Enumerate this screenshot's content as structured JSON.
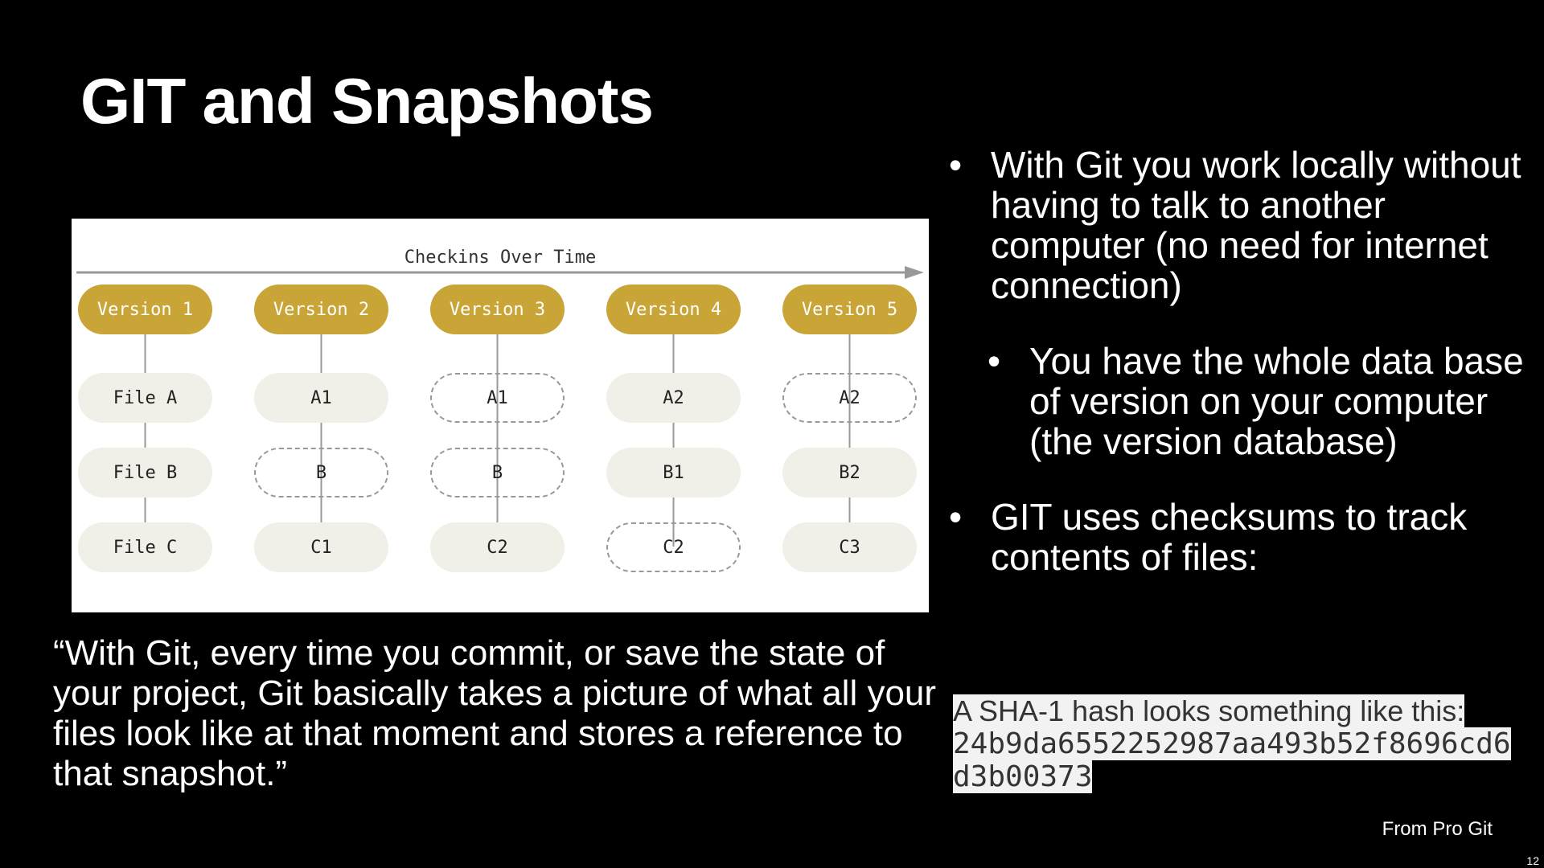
{
  "title": "GIT and Snapshots",
  "diagram": {
    "timeline_label": "Checkins Over Time",
    "columns": [
      {
        "version": "Version 1",
        "files": [
          {
            "label": "File A",
            "ref": false
          },
          {
            "label": "File B",
            "ref": false
          },
          {
            "label": "File C",
            "ref": false
          }
        ]
      },
      {
        "version": "Version 2",
        "files": [
          {
            "label": "A1",
            "ref": false
          },
          {
            "label": "B",
            "ref": true
          },
          {
            "label": "C1",
            "ref": false
          }
        ]
      },
      {
        "version": "Version 3",
        "files": [
          {
            "label": "A1",
            "ref": true
          },
          {
            "label": "B",
            "ref": true
          },
          {
            "label": "C2",
            "ref": false
          }
        ]
      },
      {
        "version": "Version 4",
        "files": [
          {
            "label": "A2",
            "ref": false
          },
          {
            "label": "B1",
            "ref": false
          },
          {
            "label": "C2",
            "ref": true
          }
        ]
      },
      {
        "version": "Version 5",
        "files": [
          {
            "label": "A2",
            "ref": true
          },
          {
            "label": "B2",
            "ref": false
          },
          {
            "label": "C3",
            "ref": false
          }
        ]
      }
    ],
    "colors": {
      "version": "#c9a437",
      "file": "#f0efe8",
      "line": "#999999"
    }
  },
  "quote": "“With Git, every time you commit, or save the state of your project, Git basically takes a picture of what all your files look like at that moment and stores a reference to that snapshot.”",
  "bullets": [
    "With Git you work locally without having to talk to another computer (no need for internet connection)",
    "You have the whole data base of version on your computer (the version database)",
    "GIT uses checksums to track contents of files:"
  ],
  "bullet_symbol": "•",
  "sha": {
    "intro": "A SHA-1 hash looks something like this:",
    "hash": "24b9da6552252987aa493b52f8696cd6d3b00373"
  },
  "source": "From Pro Git",
  "page_number": "12"
}
